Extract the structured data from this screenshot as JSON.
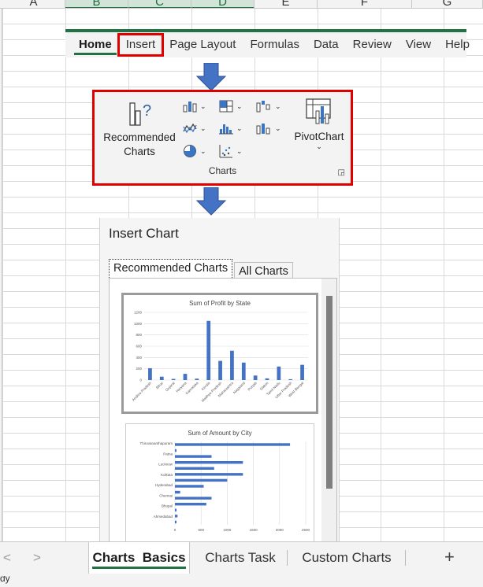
{
  "columns": [
    "A",
    "B",
    "C",
    "D",
    "E",
    "F",
    "G"
  ],
  "ribbon": {
    "tabs": [
      {
        "label": "Home",
        "active": true
      },
      {
        "label": "Insert",
        "highlighted": true
      },
      {
        "label": "Page Layout"
      },
      {
        "label": "Formulas"
      },
      {
        "label": "Data"
      },
      {
        "label": "Review"
      },
      {
        "label": "View"
      },
      {
        "label": "Help"
      }
    ]
  },
  "charts_group": {
    "recommended_label_line1": "Recommended",
    "recommended_label_line2": "Charts",
    "pivot_label": "PivotChart",
    "group_label": "Charts",
    "icons": [
      "column-chart-icon",
      "hierarchy-chart-icon",
      "waterfall-chart-icon",
      "line-chart-icon",
      "statistic-chart-icon",
      "combo-chart-icon",
      "pie-chart-icon",
      "scatter-chart-icon"
    ]
  },
  "dialog": {
    "title": "Insert Chart",
    "tab_recommended": "Recommended Charts",
    "tab_all": "All Charts"
  },
  "chart_data": [
    {
      "type": "bar",
      "title": "Sum of Profit by State",
      "categories": [
        "Andhra Pradesh",
        "Bihar",
        "Gujarat",
        "Haryana",
        "Karnataka",
        "Kerala",
        "Madhya Pradesh",
        "Maharashtra",
        "Nagaland",
        "Punjab",
        "Sikkim",
        "Tamil Nadu",
        "Uttar Pradesh",
        "West Bengal"
      ],
      "values": [
        210,
        60,
        20,
        110,
        25,
        1050,
        340,
        520,
        310,
        80,
        30,
        240,
        15,
        270
      ],
      "y_ticks": [
        0,
        200,
        400,
        600,
        800,
        1000,
        1200
      ],
      "ylim": [
        0,
        1200
      ],
      "grid": true
    },
    {
      "type": "bar",
      "orientation": "horizontal",
      "title": "Sum of Amount by City",
      "categories": [
        "Thiruvananthapuram",
        "Patna",
        "Lucknow",
        "Kolkata",
        "Hyderabad",
        "Chennai",
        "Bhopal",
        "Ahmedabad"
      ],
      "x_ticks": [
        0,
        500,
        1000,
        1500,
        2000,
        2500
      ],
      "xlim": [
        0,
        2500
      ],
      "bars": [
        2200,
        30,
        700,
        1300,
        750,
        1300,
        1000,
        550,
        100,
        700,
        600,
        30,
        50,
        30
      ],
      "grid": true
    }
  ],
  "sheet_tabs": {
    "items": [
      {
        "label": "Charts  Basics",
        "active": true
      },
      {
        "label": "Charts Task"
      },
      {
        "label": "Custom Charts"
      }
    ],
    "prev": "<",
    "next": ">",
    "add": "+"
  },
  "status": {
    "text": "dy"
  }
}
